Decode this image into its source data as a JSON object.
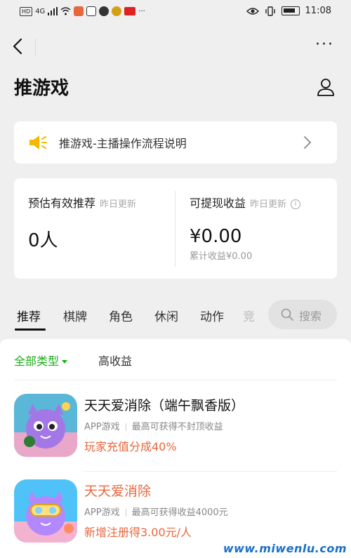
{
  "status_bar": {
    "hd_badge": "HD",
    "network": "4G",
    "time": "11:08",
    "dots": "···"
  },
  "nav": {
    "more": "···"
  },
  "page": {
    "title": "推游戏"
  },
  "guide": {
    "text": "推游戏-主播操作流程说明"
  },
  "stats": {
    "referrals_label": "预估有效推荐",
    "referrals_sub": "昨日更新",
    "referrals_value": "0人",
    "income_label": "可提现收益",
    "income_sub": "昨日更新",
    "income_value": "¥0.00",
    "income_total": "累计收益¥0.00",
    "info_glyph": "i"
  },
  "tabs": {
    "items": [
      "推荐",
      "棋牌",
      "角色",
      "休闲",
      "动作"
    ],
    "partial": "竞",
    "search_label": "搜索"
  },
  "filters": {
    "all_types": "全部类型",
    "high_income": "高收益"
  },
  "games": [
    {
      "title": "天天爱消除（端午飘香版）",
      "category": "APP游戏",
      "earning": "最高可获得不封顶收益",
      "reward": "玩家充值分成40%"
    },
    {
      "title": "天天爱消除",
      "category": "APP游戏",
      "earning": "最高可获得收益4000元",
      "reward": "新增注册得3.00元/人"
    }
  ],
  "watermark": "www.miwenlu.com",
  "colors": {
    "accent_green": "#1aad19",
    "reward_orange": "#e8663d",
    "speaker_yellow": "#f5b800",
    "background": "#efefef"
  }
}
